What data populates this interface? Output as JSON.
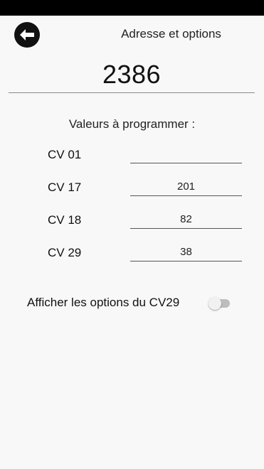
{
  "header": {
    "back_icon": "arrow-left-icon",
    "title": "Adresse et options"
  },
  "address": {
    "value": "2386"
  },
  "cv_section": {
    "title": "Valeurs à programmer :",
    "rows": [
      {
        "label": "CV 01",
        "value": ""
      },
      {
        "label": "CV 17",
        "value": "201"
      },
      {
        "label": "CV 18",
        "value": "82"
      },
      {
        "label": "CV 29",
        "value": "38"
      }
    ]
  },
  "options": {
    "label": "Afficher les options du CV29",
    "toggle_on": false
  },
  "colors": {
    "background": "#f8f8f8",
    "status_bar": "#000000",
    "toggle_track_off": "#bdbdbd"
  }
}
